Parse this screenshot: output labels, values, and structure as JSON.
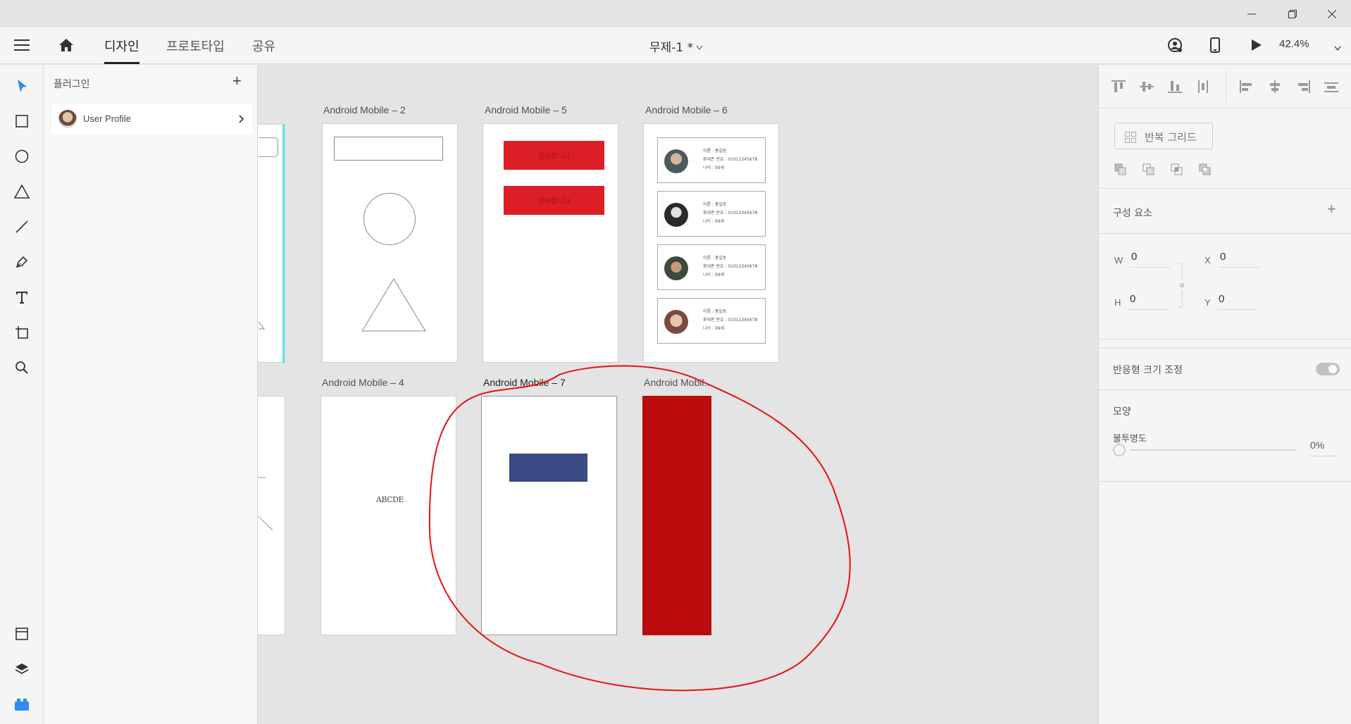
{
  "window": {
    "controls": [
      "minimize-icon",
      "restore-icon",
      "close-icon"
    ]
  },
  "menubar": {
    "tabs": [
      "디자인",
      "프로토타입",
      "공유"
    ],
    "active_tab": "디자인",
    "document_title": "무제-1 *",
    "zoom": "42.4%"
  },
  "tools": [
    "select-tool",
    "rectangle-tool",
    "ellipse-tool",
    "triangle-tool",
    "line-tool",
    "pen-tool",
    "text-tool",
    "artboard-tool",
    "zoom-tool"
  ],
  "bottom_tools": [
    "assets-icon",
    "layers-icon",
    "plugins-icon"
  ],
  "plugins_panel": {
    "title": "플러그인",
    "add_label": "+",
    "items": [
      {
        "name": "User Profile"
      }
    ]
  },
  "canvas": {
    "artboards": {
      "m2": "Android Mobile – 2",
      "m5": "Android Mobile – 5",
      "m6": "Android Mobile – 6",
      "m4": "Android Mobile – 4",
      "m7": "Android Mobile – 7",
      "m8": "Android Mobil..."
    },
    "m5_button_text": "감사합니다",
    "m4_text": "ABCDE",
    "m6_cards": [
      {
        "name": "이름 : 홍길동",
        "phone": "휴대폰 번호 : 01012345678",
        "age": "나이 : 99세"
      },
      {
        "name": "이름 : 홍길동",
        "phone": "휴대폰 번호 : 01012345678",
        "age": "나이 : 99세"
      },
      {
        "name": "이름 : 홍길동",
        "phone": "휴대폰 번호 : 01012345678",
        "age": "나이 : 99세"
      },
      {
        "name": "이름 : 홍길동",
        "phone": "휴대폰 번호 : 01012345678",
        "age": "나이 : 99세"
      }
    ],
    "colors": {
      "red_button": "#dc1f26",
      "navy_rect": "#394a84",
      "dark_red": "#bb0b0d",
      "annotation": "#e81010",
      "guide": "#5ee6ee"
    }
  },
  "properties": {
    "repeat_grid": "반복 그리드",
    "components": "구성 요소",
    "components_add": "+",
    "w_label": "W",
    "w_value": "0",
    "h_label": "H",
    "h_value": "0",
    "x_label": "X",
    "x_value": "0",
    "y_label": "Y",
    "y_value": "0",
    "responsive_resize": "반응형 크기 조정",
    "appearance": "모양",
    "opacity_label": "불투명도",
    "opacity_value": "0%"
  }
}
